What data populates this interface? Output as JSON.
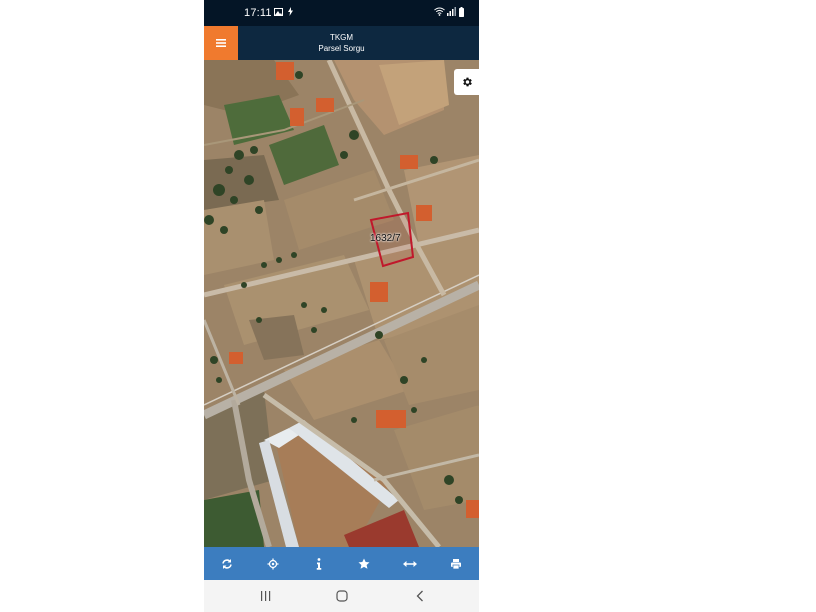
{
  "status_bar": {
    "time": "17:11",
    "left_icons": [
      "gallery-icon",
      "charging-icon"
    ],
    "right_icons": [
      "wifi-icon",
      "signal-icon",
      "battery-icon"
    ]
  },
  "app_bar": {
    "title": "TKGM",
    "subtitle": "Parsel Sorgu",
    "menu_icon": "hamburger-menu-icon",
    "accent_color": "#f07a2e",
    "bar_color": "#0d2840"
  },
  "map": {
    "parcel_label": "1632/7",
    "parcel_color": "#c0182b",
    "settings_icon": "gear-icon"
  },
  "toolbar": {
    "color": "#3c7dbf",
    "items": [
      {
        "name": "refresh-icon"
      },
      {
        "name": "locate-icon"
      },
      {
        "name": "info-icon"
      },
      {
        "name": "star-icon"
      },
      {
        "name": "measure-icon"
      },
      {
        "name": "print-icon"
      }
    ]
  },
  "nav_bar": {
    "items": [
      "recent-apps-icon",
      "home-icon",
      "back-icon"
    ]
  }
}
